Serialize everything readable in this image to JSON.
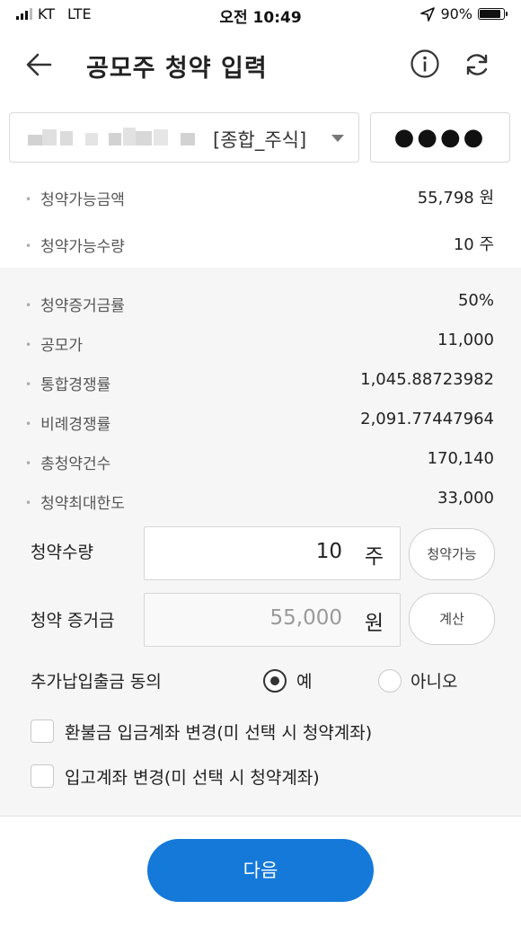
{
  "status_bar": {
    "carrier": "KT",
    "network": "LTE",
    "time": "오전 10:49",
    "battery": "90%",
    "battery_level": 0.9
  },
  "header": {
    "title": "공모주 청약 입력"
  },
  "account": {
    "type": "[종합_주식]",
    "password_mask": "●●●●"
  },
  "summary": [
    {
      "label": "청약가능금액",
      "value": "55,798 원"
    },
    {
      "label": "청약가능수량",
      "value": "10 주"
    }
  ],
  "details": [
    {
      "label": "청약증거금률",
      "value": "50%"
    },
    {
      "label": "공모가",
      "value": "11,000"
    },
    {
      "label": "통합경쟁률",
      "value": "1,045.88723982"
    },
    {
      "label": "비례경쟁률",
      "value": "2,091.77447964"
    },
    {
      "label": "총청약건수",
      "value": "170,140"
    },
    {
      "label": "청약최대한도",
      "value": "33,000"
    }
  ],
  "form": {
    "quantity_label": "청약수량",
    "quantity_value": "10",
    "quantity_unit": "주",
    "quantity_button": "청약가능",
    "deposit_label": "청약 증거금",
    "deposit_value": "55,000",
    "deposit_unit": "원",
    "deposit_button": "계산",
    "consent_label": "추가납입출금 동의",
    "consent_yes": "예",
    "consent_no": "아니오",
    "refund_account_label": "환불금 입금계좌 변경(미 선택 시 청약계좌)",
    "stock_account_label": "입고계좌 변경(미 선택 시 청약계좌)"
  },
  "next_button": "다음"
}
